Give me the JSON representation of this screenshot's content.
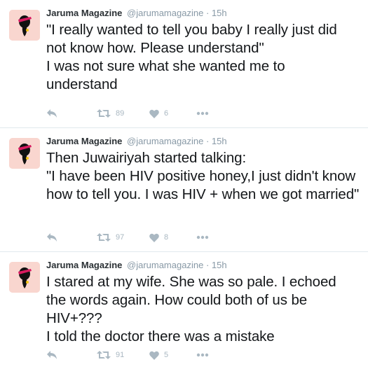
{
  "colors": {
    "avatar_bg": "#f9d6cf",
    "icon_gray": "#aab8c2",
    "meta_gray": "#8899a6",
    "divider": "#e1e8ed"
  },
  "icons": [
    "avatar-icon",
    "reply-icon",
    "retweet-icon",
    "heart-icon",
    "more-icon"
  ],
  "tweets": [
    {
      "name": "Jaruma Magazine",
      "handle": "@jarumamagazine",
      "sep": "·",
      "time": "15h",
      "lines": [
        "\"I really wanted to tell you baby I really just did not know how. Please understand\"",
        "I was not sure what she wanted me to understand"
      ],
      "retweets": "89",
      "likes": "6"
    },
    {
      "name": "Jaruma Magazine",
      "handle": "@jarumamagazine",
      "sep": "·",
      "time": "15h",
      "lines": [
        "Then Juwairiyah started talking:",
        "\"I have been HIV positive honey,I just didn't know how to tell you. I was HIV + when we got married\""
      ],
      "retweets": "97",
      "likes": "8"
    },
    {
      "name": "Jaruma Magazine",
      "handle": "@jarumamagazine",
      "sep": "·",
      "time": "15h",
      "lines": [
        "I stared at my wife. She was so pale. I echoed the words again. How could both of us be HIV+???",
        "I told the doctor there was a mistake"
      ],
      "retweets": "91",
      "likes": "5"
    }
  ]
}
